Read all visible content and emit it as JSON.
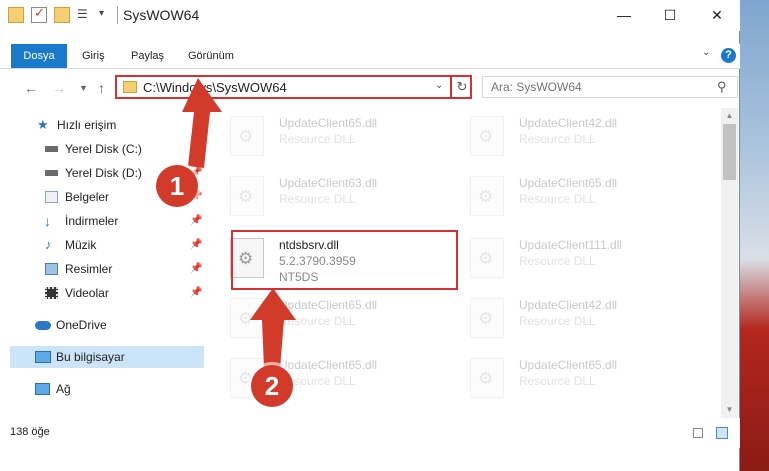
{
  "window": {
    "title": "SysWOW64"
  },
  "window_buttons": {
    "minimize": "—",
    "maximize": "☐",
    "close": "✕"
  },
  "ribbon": {
    "tabs": [
      "Dosya",
      "Giriş",
      "Paylaş",
      "Görünüm"
    ],
    "help": "?"
  },
  "address": {
    "path": "C:\\Windows\\SysWOW64"
  },
  "search": {
    "placeholder": "Ara: SysWOW64"
  },
  "sidebar": {
    "items": [
      {
        "label": "Hızlı erişim",
        "icon": "star-icon"
      },
      {
        "label": "Yerel Disk (C:)",
        "icon": "drive-icon"
      },
      {
        "label": "Yerel Disk (D:)",
        "icon": "drive-icon"
      },
      {
        "label": "Belgeler",
        "icon": "documents-icon"
      },
      {
        "label": "İndirmeler",
        "icon": "download-icon"
      },
      {
        "label": "Müzik",
        "icon": "music-icon"
      },
      {
        "label": "Resimler",
        "icon": "pictures-icon"
      },
      {
        "label": "Videolar",
        "icon": "videos-icon"
      },
      {
        "label": "OneDrive",
        "icon": "cloud-icon"
      },
      {
        "label": "Bu bilgisayar",
        "icon": "computer-icon"
      },
      {
        "label": "Ağ",
        "icon": "network-icon"
      }
    ]
  },
  "files": [
    {
      "name": "UpdateClient65.dll",
      "desc": "Resource DLL"
    },
    {
      "name": "UpdateClient42.dll",
      "desc": "Resource DLL"
    },
    {
      "name": "UpdateClient63.dll",
      "desc": "Resource DLL"
    },
    {
      "name": "UpdateClient65.dll",
      "desc": "Resource DLL"
    },
    {
      "name": "ntdsbsrv.dll",
      "version": "5.2.3790.3959",
      "company": "NT5DS"
    },
    {
      "name": "UpdateClient111.dll",
      "desc": "Resource DLL"
    },
    {
      "name": "UpdateClient65.dll",
      "desc": "Resource DLL"
    },
    {
      "name": "UpdateClient42.dll",
      "desc": "Resource DLL"
    },
    {
      "name": "UpdateClient65.dll",
      "desc": "Resource DLL"
    },
    {
      "name": "UpdateClient65.dll",
      "desc": "Resource DLL"
    }
  ],
  "status": {
    "item_count": "138 öğe"
  },
  "annotations": {
    "step1": "1",
    "step2": "2"
  },
  "colors": {
    "accent": "#1979ca",
    "highlight": "#d83030",
    "selection": "#cce4f7"
  }
}
